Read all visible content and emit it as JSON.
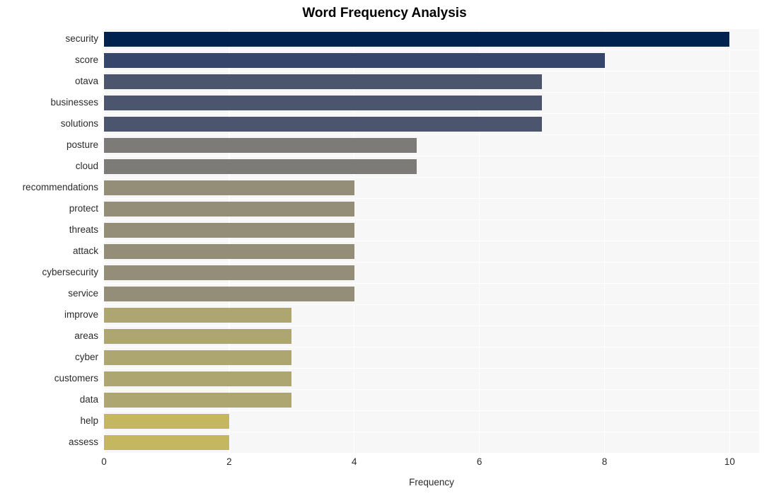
{
  "chart_data": {
    "type": "bar",
    "orientation": "horizontal",
    "title": "Word Frequency Analysis",
    "xlabel": "Frequency",
    "ylabel": "",
    "xlim": [
      0,
      10.47
    ],
    "xticks": [
      0,
      2,
      4,
      6,
      8,
      10
    ],
    "xtick_labels": [
      "0",
      "2",
      "4",
      "6",
      "8",
      "10"
    ],
    "grid": true,
    "grid_color": "#ffffff",
    "plot_background": "#f7f7f7",
    "legend": null,
    "categories": [
      "security",
      "score",
      "otava",
      "businesses",
      "solutions",
      "posture",
      "cloud",
      "recommendations",
      "protect",
      "threats",
      "attack",
      "cybersecurity",
      "service",
      "improve",
      "areas",
      "cyber",
      "customers",
      "data",
      "help",
      "assess"
    ],
    "values": [
      10,
      8,
      7,
      7,
      7,
      5,
      5,
      4,
      4,
      4,
      4,
      4,
      4,
      3,
      3,
      3,
      3,
      3,
      2,
      2
    ],
    "bar_colors": [
      "#00224e",
      "#35456b",
      "#4c556e",
      "#4c556e",
      "#4c556e",
      "#7c7b78",
      "#7c7b78",
      "#948e78",
      "#948e78",
      "#948e78",
      "#948e78",
      "#948e78",
      "#948e78",
      "#aea671",
      "#aea671",
      "#aea671",
      "#aea671",
      "#aea671",
      "#c5b75f",
      "#c5b75f"
    ]
  }
}
